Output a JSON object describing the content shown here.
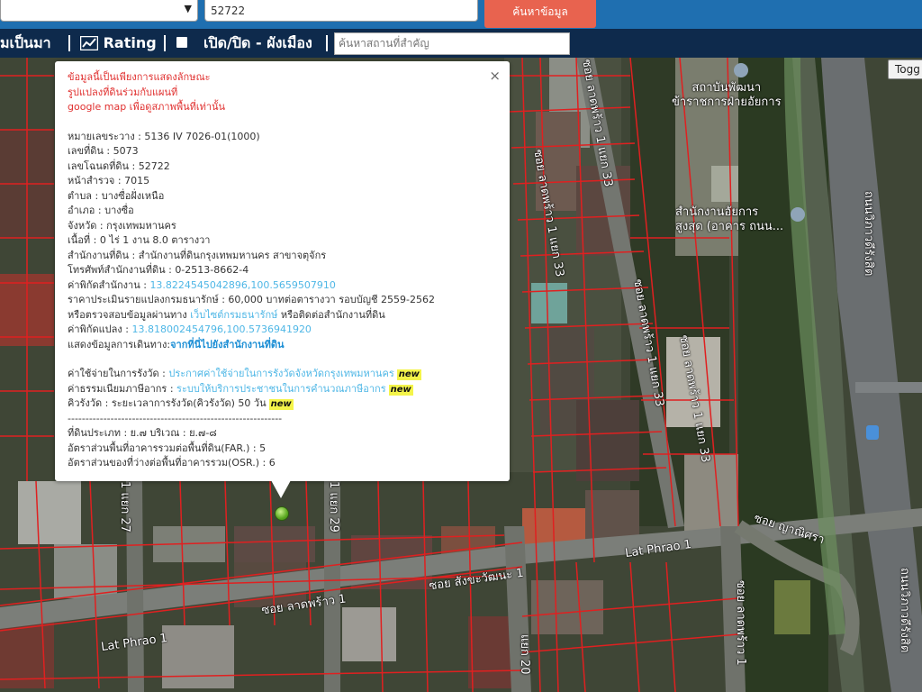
{
  "search": {
    "query_value": "52722",
    "button_label": "ค้นหาข้อมูล"
  },
  "toolbar": {
    "item_history": "มเป็นมา",
    "item_rating": "Rating",
    "item_toggle_layer": "เปิด/ปิด - ผังเมือง",
    "place_search_placeholder": "ค้นหาสถานที่สำคัญ"
  },
  "map": {
    "toggle_label": "Togg",
    "road_labels": {
      "lat_phrao_1_right": "Lat Phrao 1",
      "lat_phrao_1_left": "Lat Phrao 1",
      "soi_lat_phrao_1": "ซอย ลาดพร้าว 1",
      "soi_sangkha": "ซอย สังขะวัฒนะ 1",
      "soi_yanisra": "ซอย ญาณิศรา",
      "soi_lp_1_33a": "ซอย ลาดพร้าว 1 แยก 33",
      "soi_lp_1_33b": "ซอย ลาดพร้าว 1 แยก 33",
      "soi_lp_1_33c": "ซอย ลาดพร้าว 1 แยก 33",
      "soi_lp_1_33d": "ซอย ลาดพร้าว 1 แยก 33",
      "lp_1_29": "1 แยก 29",
      "lp_1_27": "1 แยก 27",
      "lp_1_20": "แยก 20",
      "soi_lp_1_right": "ซอย ลาดพร้าว 1",
      "vibhavadi_1": "ถนนวิภาวดีรังสิต",
      "vibhavadi_2": "ถนนวิภาวดีรังสิต",
      "institute": "สถาบันพัฒนา\nข้าราชการฝ่ายอัยการ",
      "attorney_office": "สำนักงานอัยการ\nสูงสุด (อาคาร ถนน..."
    }
  },
  "popup": {
    "close_label": "×",
    "disclaimer": [
      "ข้อมูลนี้เป็นเพียงการแสดงลักษณะ",
      "รูปแปลงที่ดินร่วมกับแผนที่",
      "google map เพื่อดูสภาพพื้นที่เท่านั้น"
    ],
    "parcel": {
      "sheet_label": "หมายเลขระวาง : ",
      "sheet_value": "5136 IV 7026-01(1000)",
      "land_no_label": "เลขที่ดิน : ",
      "land_no_value": "5073",
      "deed_label": "เลขโฉนดที่ดิน : ",
      "deed_value": "52722",
      "survey_label": "หน้าสำรวจ : ",
      "survey_value": "7015",
      "subdistrict_label": "ตำบล : ",
      "subdistrict_value": "บางซื่อฝั่งเหนือ",
      "district_label": "อำเภอ : ",
      "district_value": "บางซื่อ",
      "province_label": "จังหวัด : ",
      "province_value": "กรุงเทพมหานคร",
      "area_label": "เนื้อที่ : ",
      "area_value": "0 ไร่ 1 งาน 8.0 ตารางวา",
      "office_label": "สำนักงานที่ดิน : ",
      "office_value": "สำนักงานที่ดินกรุงเทพมหานคร สาขาจตุจักร",
      "phone_label": "โทรศัพท์สำนักงานที่ดิน : ",
      "phone_value": "0-2513-8662-4",
      "office_coord_label": "ค่าพิกัดสำนักงาน : ",
      "office_coord_value": "13.8224545042896,100.5659507910",
      "price_label": "ราคาประเมินรายแปลงกรมธนารักษ์ : ",
      "price_value": "60,000 บาทต่อตารางวา รอบบัญชี 2559-2562",
      "verify_prefix": "หรือตรวจสอบข้อมูลผ่านทาง ",
      "verify_link": "เว็บไซต์กรมธนารักษ์",
      "verify_suffix": " หรือติดต่อสำนักงานที่ดิน",
      "parcel_coord_label": "ค่าพิกัดแปลง : ",
      "parcel_coord_value": "13.818002454796,100.5736941920",
      "route_label": "แสดงข้อมูลการเดินทาง:",
      "route_link": "จากที่นี่ไปยังสำนักงานที่ดิน"
    },
    "fees": {
      "survey_fee_label": "ค่าใช้จ่ายในการรังวัด : ",
      "survey_fee_link": "ประกาศค่าใช้จ่ายในการรังวัดจังหวัดกรุงเทพมหานคร",
      "tax_label": "ค่าธรรมเนียมภาษีอากร : ",
      "tax_link": "ระบบให้บริการประชาชนในการคำนวณภาษีอากร",
      "queue_label": "คิวรังวัด : ",
      "queue_value": "ระยะเวลาการรังวัด(คิวรังวัด) 50 วัน",
      "new_badge": "new"
    },
    "divider": "------------------------------------------------------------",
    "zoning": {
      "land_type": "ที่ดินประเภท : ย.๗ บริเวณ : ย.๗-๘",
      "far": "อัตราส่วนพื้นที่อาคารรวมต่อพื้นที่ดิน(FAR.) : 5",
      "osr": "อัตราส่วนของที่ว่างต่อพื้นที่อาคารรวม(OSR.) : 6"
    }
  },
  "colors": {
    "topbar": "#1f6fb0",
    "toolbar": "#0e2a4c",
    "search_button": "#e8634f",
    "parcel_lines": "#e02020",
    "disclaimer_text": "#e0302f",
    "link_text": "#4fb7e6",
    "new_badge": "#f4f44a",
    "marker": "#5aa820"
  }
}
